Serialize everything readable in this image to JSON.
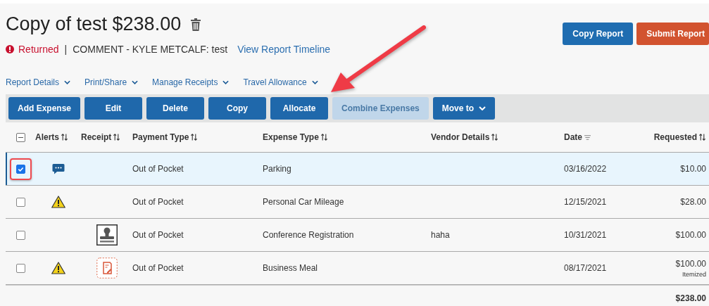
{
  "report": {
    "title": "Copy of test $238.00",
    "status": "Returned",
    "separator": "|",
    "comment": "COMMENT - KYLE METCALF: test",
    "timeline_link": "View Report Timeline"
  },
  "header_buttons": [
    {
      "label": "Copy Report",
      "kind": "primary"
    },
    {
      "label": "Submit Report",
      "kind": "submit"
    }
  ],
  "menus": [
    "Report Details",
    "Print/Share",
    "Manage Receipts",
    "Travel Allowance"
  ],
  "toolbar": [
    {
      "label": "Add Expense",
      "disabled": false,
      "dropdown": false
    },
    {
      "label": "Edit",
      "disabled": false,
      "dropdown": false
    },
    {
      "label": "Delete",
      "disabled": false,
      "dropdown": false
    },
    {
      "label": "Copy",
      "disabled": false,
      "dropdown": false
    },
    {
      "label": "Allocate",
      "disabled": false,
      "dropdown": false
    },
    {
      "label": "Combine Expenses",
      "disabled": true,
      "dropdown": false
    },
    {
      "label": "Move to",
      "disabled": false,
      "dropdown": true
    }
  ],
  "table": {
    "select_all": {
      "indeterminate": true
    },
    "columns": [
      {
        "label": "Alerts",
        "sorted": false
      },
      {
        "label": "Receipt",
        "sorted": false
      },
      {
        "label": "Payment Type",
        "sorted": false
      },
      {
        "label": "Expense Type",
        "sorted": false
      },
      {
        "label": "Vendor Details",
        "sorted": false
      },
      {
        "label": "Date",
        "sorted": true
      },
      {
        "label": "Requested",
        "sorted": false
      }
    ],
    "rows": [
      {
        "selected": true,
        "alert": {
          "kind": "comment"
        },
        "payment_type": "Out of Pocket",
        "expense_type": "Parking",
        "date": "03/16/2022",
        "requested": "$10.00"
      },
      {
        "selected": false,
        "alert": {
          "kind": "warning"
        },
        "payment_type": "Out of Pocket",
        "expense_type": "Personal Car Mileage",
        "date": "12/15/2021",
        "requested": "$28.00"
      },
      {
        "selected": false,
        "receipt": {
          "kind": "image"
        },
        "payment_type": "Out of Pocket",
        "expense_type": "Conference Registration",
        "vendor": "haha",
        "date": "10/31/2021",
        "requested": "$100.00"
      },
      {
        "selected": false,
        "alert": {
          "kind": "warning"
        },
        "receipt": {
          "kind": "missing"
        },
        "payment_type": "Out of Pocket",
        "expense_type": "Business Meal",
        "date": "08/17/2021",
        "requested": "$100.00",
        "note": "Itemized"
      }
    ],
    "total": "$238.00"
  }
}
